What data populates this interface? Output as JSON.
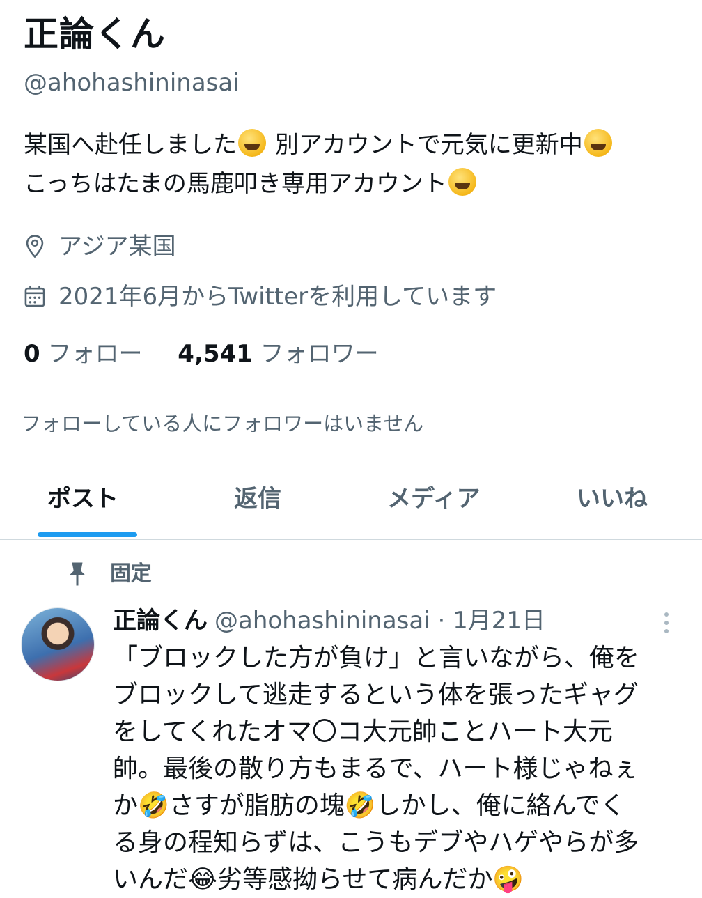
{
  "profile": {
    "name": "正論くん",
    "handle": "@ahohashininasai",
    "bio_line1_a": "某国へ赴任しました",
    "bio_line1_b": "別アカウントで元気に更新中",
    "bio_line2": "こっちはたまの馬鹿叩き専用アカウント",
    "location": "アジア某国",
    "joined": "2021年6月からTwitterを利用しています",
    "following_count": "0",
    "following_label": "フォロー",
    "followers_count": "4,541",
    "followers_label": "フォロワー",
    "followers_note": "フォローしている人にフォロワーはいません"
  },
  "tabs": [
    {
      "label": "ポスト",
      "active": true
    },
    {
      "label": "返信",
      "active": false
    },
    {
      "label": "メディア",
      "active": false
    },
    {
      "label": "いいね",
      "active": false
    }
  ],
  "pinned_label": "固定",
  "tweet": {
    "name": "正論くん",
    "handle_date": "@ahohashininasai · 1月21日",
    "lines": [
      "「ブロックした方が負け」と言いながら、俺を",
      "ブロックして逃走するという体を張ったギャグ",
      "をしてくれたオマ〇コ大元帥ことハート大元",
      "帥。最後の散り方もまるで、ハート様じゃねぇ",
      "か🤣さすが脂肪の塊🤣しかし、俺に絡んでく",
      "る身の程知らずは、こうもデブやハゲやらが多",
      "いんだ😂劣等感拗らせて病んだか🤪"
    ]
  },
  "icons": [
    "location-pin-icon",
    "calendar-icon",
    "pin-icon",
    "more-vertical-icon"
  ],
  "colors": {
    "accent": "#1d9bf0",
    "secondary_text": "#536471",
    "primary_text": "#0f1419"
  }
}
